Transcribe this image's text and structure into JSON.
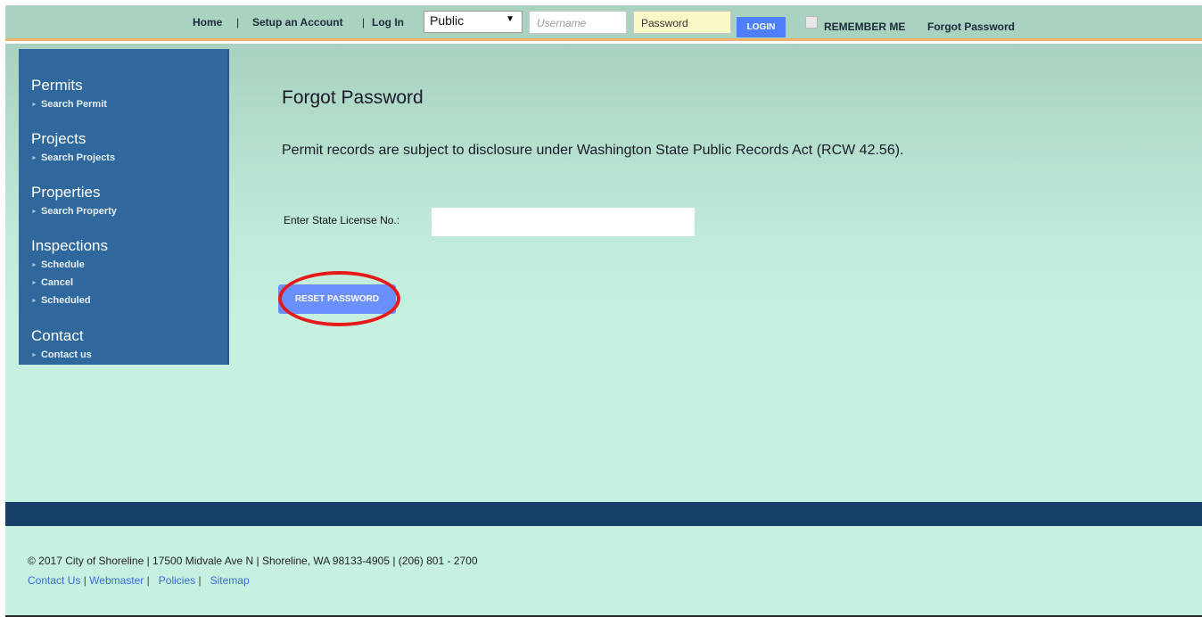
{
  "topnav": {
    "home": "Home",
    "sep1": "|",
    "setup_account": "Setup an Account",
    "sep2": "|",
    "log_in": "Log In",
    "role_select": "Public",
    "username_placeholder": "Username",
    "password_value": "Password",
    "login_button": "LOGIN",
    "remember_me": "REMEMBER ME",
    "forgot_password": "Forgot Password"
  },
  "sidebar": {
    "sections": [
      {
        "heading": "Permits",
        "items": [
          "Search Permit"
        ]
      },
      {
        "heading": "Projects",
        "items": [
          "Search Projects"
        ]
      },
      {
        "heading": "Properties",
        "items": [
          "Search Property"
        ]
      },
      {
        "heading": "Inspections",
        "items": [
          "Schedule",
          "Cancel",
          "Scheduled"
        ]
      },
      {
        "heading": "Contact",
        "items": [
          "Contact us"
        ]
      }
    ],
    "item_marker": "►"
  },
  "main": {
    "title": "Forgot Password",
    "notice": "Permit records are subject to disclosure under Washington State Public Records Act (RCW 42.56).",
    "license_label": "Enter State License No.:",
    "license_value": "",
    "reset_button": "RESET PASSWORD"
  },
  "footer": {
    "info": "© 2017 City of Shoreline | 17500 Midvale Ave N | Shoreline, WA 98133-4905 | (206) 801 - 2700",
    "links": [
      "Contact Us",
      "Webmaster",
      "Policies",
      "Sitemap"
    ]
  },
  "colors": {
    "sidebar": "#2f689c",
    "highlight": "#e51b1b",
    "button": "#6a90ff",
    "footer_band": "#163f6a"
  }
}
